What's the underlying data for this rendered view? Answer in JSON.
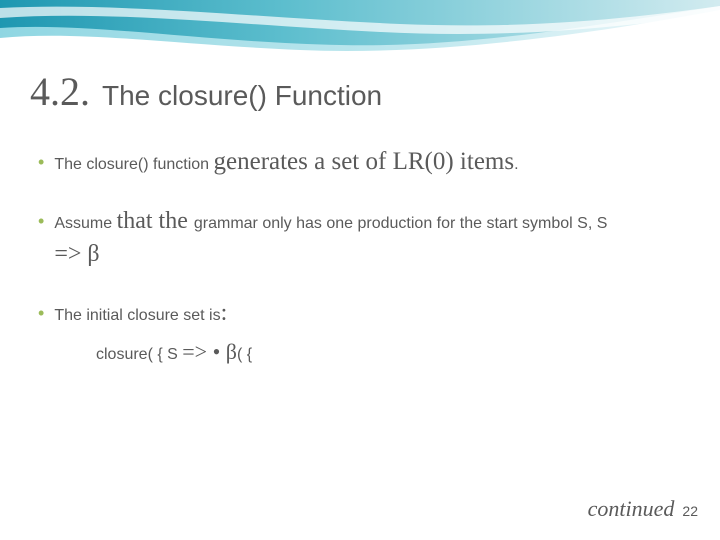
{
  "title": {
    "number": "4.2.",
    "text": "The closure() Function"
  },
  "bullets": {
    "b1_prefix": "The closure() function ",
    "b1_emph": "generates a set of LR(0) items",
    "b1_suffix": ".",
    "b2_prefix": "Assume ",
    "b2_emph": "that the ",
    "b2_suffix": "grammar only has one production for the start symbol S, S ",
    "b2_line2_arrow": "=> ",
    "b2_line2_sym": "β",
    "b3_text": "The initial closure set is",
    "b3_colon": ":",
    "sub_prefix": "closure( { S ",
    "sub_arrow": "=> • β",
    "sub_suffix": "( {"
  },
  "footer": {
    "continued": "continued",
    "page": "22"
  }
}
